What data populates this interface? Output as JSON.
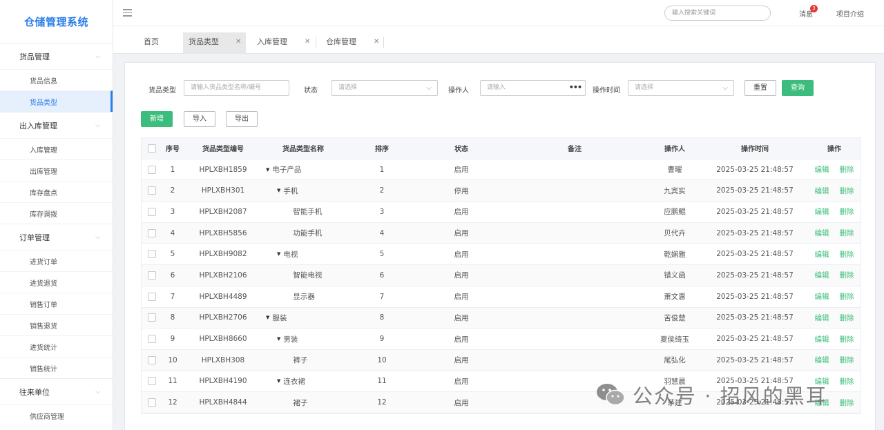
{
  "sidebar": {
    "title": "仓储管理系统",
    "groups": [
      {
        "label": "货品管理",
        "items": [
          "货品信息",
          "货品类型"
        ]
      },
      {
        "label": "出入库管理",
        "items": [
          "入库管理",
          "出库管理",
          "库存盘点",
          "库存调拨"
        ]
      },
      {
        "label": "订单管理",
        "items": [
          "进货订单",
          "进货退货",
          "销售订单",
          "销售退货",
          "进货统计",
          "销售统计"
        ]
      },
      {
        "label": "往来单位",
        "items": [
          "供应商管理"
        ]
      }
    ],
    "active_item": "货品类型"
  },
  "header": {
    "search_placeholder": "输入搜索关键词",
    "messages_label": "消息",
    "messages_count": "3",
    "intro_label": "项目介绍"
  },
  "tabs": [
    {
      "label": "首页",
      "closable": false
    },
    {
      "label": "货品类型",
      "closable": true,
      "active": true
    },
    {
      "label": "入库管理",
      "closable": true
    },
    {
      "label": "仓库管理",
      "closable": true
    }
  ],
  "filters": {
    "type_label": "货品类型",
    "type_placeholder": "请输入货品类型名称/编号",
    "status_label": "状态",
    "status_placeholder": "请选择",
    "operator_label": "操作人",
    "operator_placeholder": "请输入",
    "time_label": "操作时间",
    "time_placeholder": "请选择",
    "reset_label": "重置",
    "query_label": "查询"
  },
  "actions": {
    "add_label": "新增",
    "import_label": "导入",
    "export_label": "导出"
  },
  "table": {
    "columns": [
      "序号",
      "货品类型编号",
      "货品类型名称",
      "排序",
      "状态",
      "备注",
      "操作人",
      "操作时间",
      "操作"
    ],
    "edit_label": "编辑",
    "delete_label": "删除",
    "rows": [
      {
        "no": "1",
        "code": "HPLXBH1859",
        "name": "电子产品",
        "level": 0,
        "expandable": true,
        "sort": "1",
        "status": "启用",
        "remark": "",
        "operator": "曹曜",
        "time": "2025-03-25 21:48:57"
      },
      {
        "no": "2",
        "code": "HPLXBH301",
        "name": "手机",
        "level": 1,
        "expandable": true,
        "sort": "2",
        "status": "停用",
        "remark": "",
        "operator": "九宾实",
        "time": "2025-03-25 21:48:57"
      },
      {
        "no": "3",
        "code": "HPLXBH2087",
        "name": "智能手机",
        "level": 2,
        "expandable": false,
        "sort": "3",
        "status": "启用",
        "remark": "",
        "operator": "应鹏鲲",
        "time": "2025-03-25 21:48:57"
      },
      {
        "no": "4",
        "code": "HPLXBH5856",
        "name": "功能手机",
        "level": 2,
        "expandable": false,
        "sort": "4",
        "status": "启用",
        "remark": "",
        "operator": "贝代卉",
        "time": "2025-03-25 21:48:57"
      },
      {
        "no": "5",
        "code": "HPLXBH9082",
        "name": "电视",
        "level": 1,
        "expandable": true,
        "sort": "5",
        "status": "启用",
        "remark": "",
        "operator": "乾娴雅",
        "time": "2025-03-25 21:48:57"
      },
      {
        "no": "6",
        "code": "HPLXBH2106",
        "name": "智能电视",
        "level": 2,
        "expandable": false,
        "sort": "6",
        "status": "启用",
        "remark": "",
        "operator": "错义函",
        "time": "2025-03-25 21:48:57"
      },
      {
        "no": "7",
        "code": "HPLXBH4489",
        "name": "显示器",
        "level": 2,
        "expandable": false,
        "sort": "7",
        "status": "启用",
        "remark": "",
        "operator": "萧文惠",
        "time": "2025-03-25 21:48:57"
      },
      {
        "no": "8",
        "code": "HPLXBH2706",
        "name": "服装",
        "level": 0,
        "expandable": true,
        "sort": "8",
        "status": "启用",
        "remark": "",
        "operator": "苦俊楚",
        "time": "2025-03-25 21:48:57"
      },
      {
        "no": "9",
        "code": "HPLXBH8660",
        "name": "男装",
        "level": 1,
        "expandable": true,
        "sort": "9",
        "status": "启用",
        "remark": "",
        "operator": "夏侯绮玉",
        "time": "2025-03-25 21:48:57"
      },
      {
        "no": "10",
        "code": "HPLXBH308",
        "name": "裤子",
        "level": 2,
        "expandable": false,
        "sort": "10",
        "status": "启用",
        "remark": "",
        "operator": "尾弘化",
        "time": "2025-03-25 21:48:57"
      },
      {
        "no": "11",
        "code": "HPLXBH4190",
        "name": "连衣裙",
        "level": 1,
        "expandable": true,
        "sort": "11",
        "status": "启用",
        "remark": "",
        "operator": "羽慧晨",
        "time": "2025-03-25 21:48:57"
      },
      {
        "no": "12",
        "code": "HPLXBH4844",
        "name": "裙子",
        "level": 2,
        "expandable": false,
        "sort": "12",
        "status": "启用",
        "remark": "",
        "operator": "茅建",
        "time": "2025-03-25 21:48:57"
      }
    ]
  },
  "watermark": {
    "text": "公众号 · 招风的黑耳"
  },
  "colors": {
    "brand_blue": "#2b7de9",
    "action_green": "#3dbd7d",
    "badge_red": "#e53935"
  }
}
